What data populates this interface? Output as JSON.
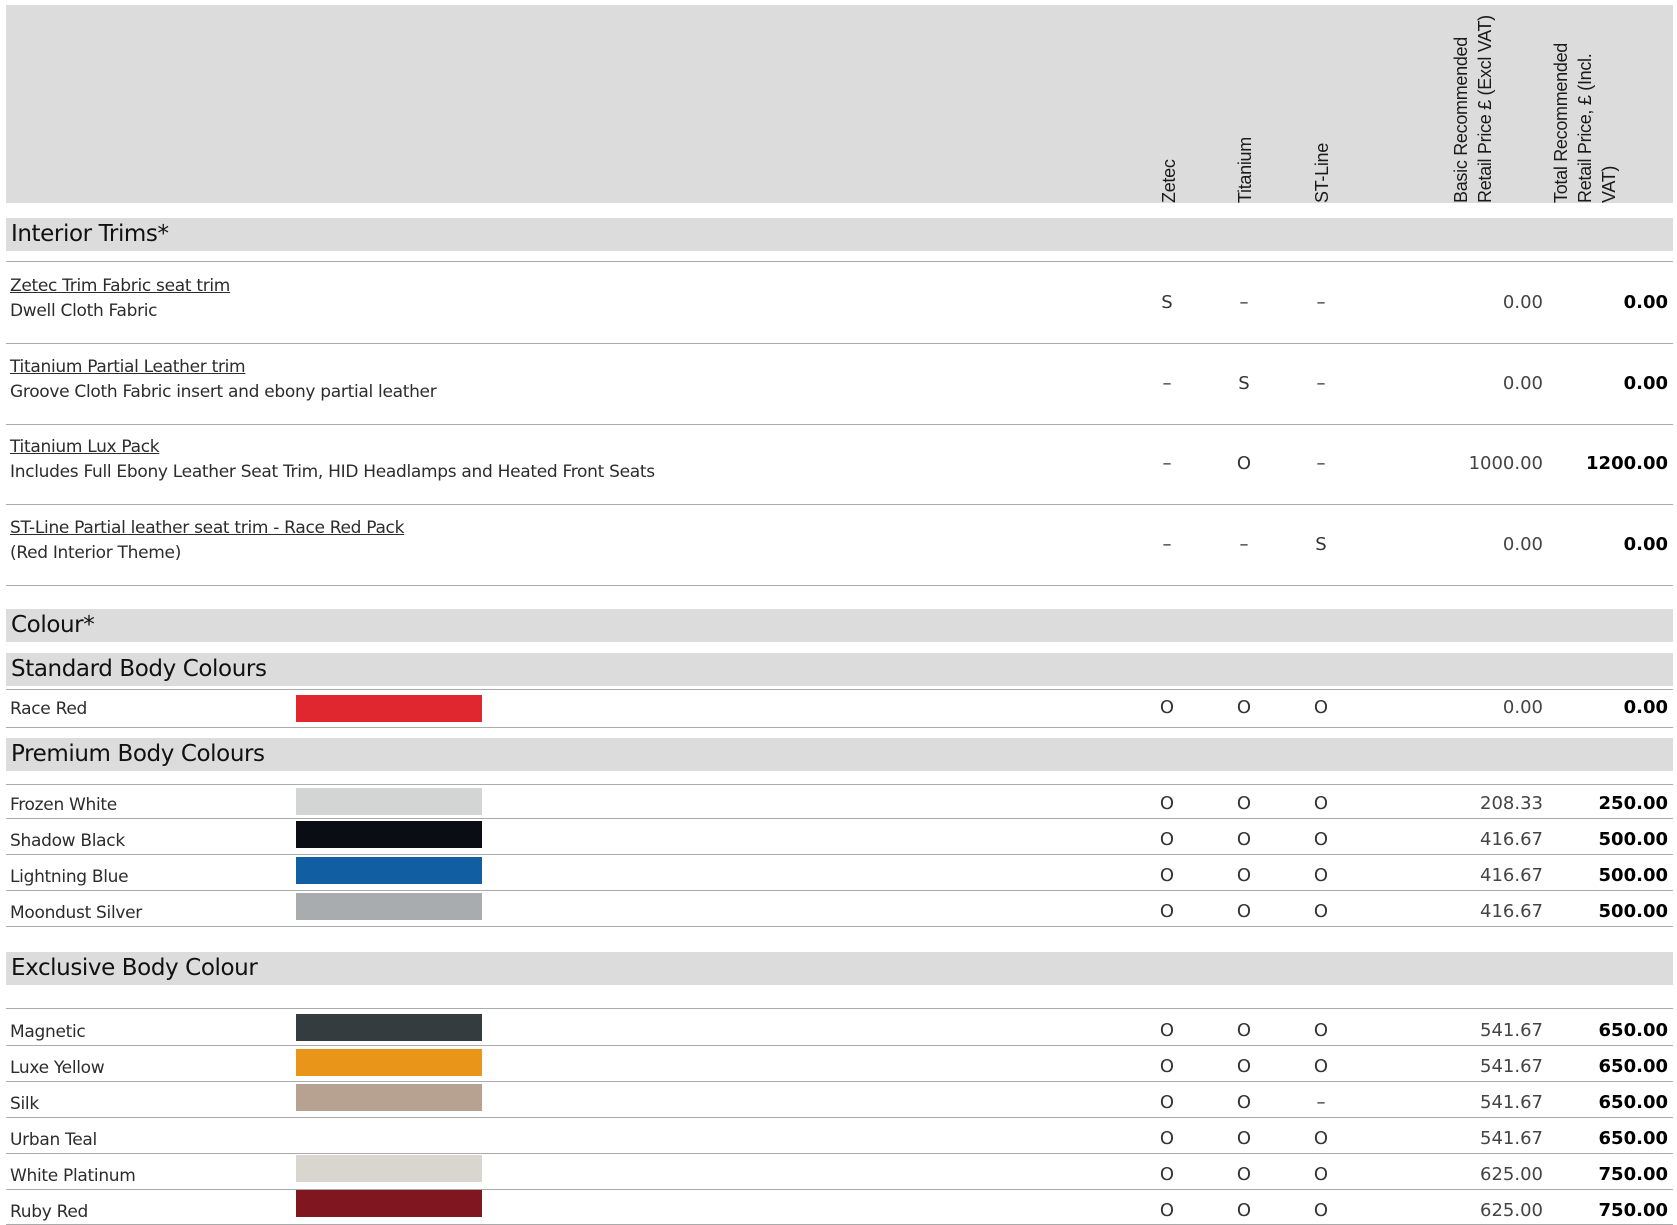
{
  "header": {
    "col_zetec": "Zetec",
    "col_titanium": "Titanium",
    "col_stline": "ST-Line",
    "col_basic": "Basic Recommended Retail Price £ (Excl VAT)",
    "col_total": "Total Recommended Retail Price, £ (Incl. VAT)"
  },
  "sections": {
    "interior_trims": "Interior Trims*",
    "colour": "Colour*",
    "standard": "Standard Body Colours",
    "premium": "Premium Body Colours",
    "exclusive": "Exclusive Body Colour"
  },
  "trims": [
    {
      "name": "Zetec Trim Fabric seat trim",
      "desc": "Dwell Cloth Fabric",
      "zetec": "S",
      "titanium": "–",
      "stline": "–",
      "basic": "0.00",
      "total": "0.00"
    },
    {
      "name": "Titanium Partial Leather trim",
      "desc": "Groove Cloth Fabric insert and ebony partial leather",
      "zetec": "–",
      "titanium": "S",
      "stline": "–",
      "basic": "0.00",
      "total": "0.00"
    },
    {
      "name": "Titanium Lux Pack",
      "desc": "Includes Full Ebony Leather Seat Trim, HID Headlamps and Heated Front Seats",
      "zetec": "–",
      "titanium": "O",
      "stline": "–",
      "basic": "1000.00",
      "total": "1200.00"
    },
    {
      "name": "ST-Line Partial leather seat trim - Race Red Pack",
      "desc": "(Red Interior Theme)",
      "zetec": "–",
      "titanium": "–",
      "stline": "S",
      "basic": "0.00",
      "total": "0.00"
    }
  ],
  "standard_colours": [
    {
      "name": "Race Red",
      "color": "#e0262e",
      "zetec": "O",
      "titanium": "O",
      "stline": "O",
      "basic": "0.00",
      "total": "0.00"
    }
  ],
  "premium_colours": [
    {
      "name": "Frozen White",
      "color": "#d3d5d5",
      "zetec": "O",
      "titanium": "O",
      "stline": "O",
      "basic": "208.33",
      "total": "250.00"
    },
    {
      "name": "Shadow Black",
      "color": "#0a0d14",
      "zetec": "O",
      "titanium": "O",
      "stline": "O",
      "basic": "416.67",
      "total": "500.00"
    },
    {
      "name": "Lightning Blue",
      "color": "#115ea3",
      "zetec": "O",
      "titanium": "O",
      "stline": "O",
      "basic": "416.67",
      "total": "500.00"
    },
    {
      "name": "Moondust Silver",
      "color": "#a9acae",
      "zetec": "O",
      "titanium": "O",
      "stline": "O",
      "basic": "416.67",
      "total": "500.00"
    }
  ],
  "exclusive_colours": [
    {
      "name": "Magnetic",
      "color": "#343c40",
      "zetec": "O",
      "titanium": "O",
      "stline": "O",
      "basic": "541.67",
      "total": "650.00"
    },
    {
      "name": "Luxe Yellow",
      "color": "#e8951a",
      "zetec": "O",
      "titanium": "O",
      "stline": "O",
      "basic": "541.67",
      "total": "650.00"
    },
    {
      "name": "Silk",
      "color": "#b7a291",
      "zetec": "O",
      "titanium": "O",
      "stline": "–",
      "basic": "541.67",
      "total": "650.00"
    },
    {
      "name": "Urban Teal",
      "color": "",
      "zetec": "O",
      "titanium": "O",
      "stline": "O",
      "basic": "541.67",
      "total": "650.00"
    },
    {
      "name": "White Platinum",
      "color": "#d9d6d0",
      "zetec": "O",
      "titanium": "O",
      "stline": "O",
      "basic": "625.00",
      "total": "750.00"
    },
    {
      "name": "Ruby Red",
      "color": "#7f1620",
      "zetec": "O",
      "titanium": "O",
      "stline": "O",
      "basic": "625.00",
      "total": "750.00"
    }
  ]
}
